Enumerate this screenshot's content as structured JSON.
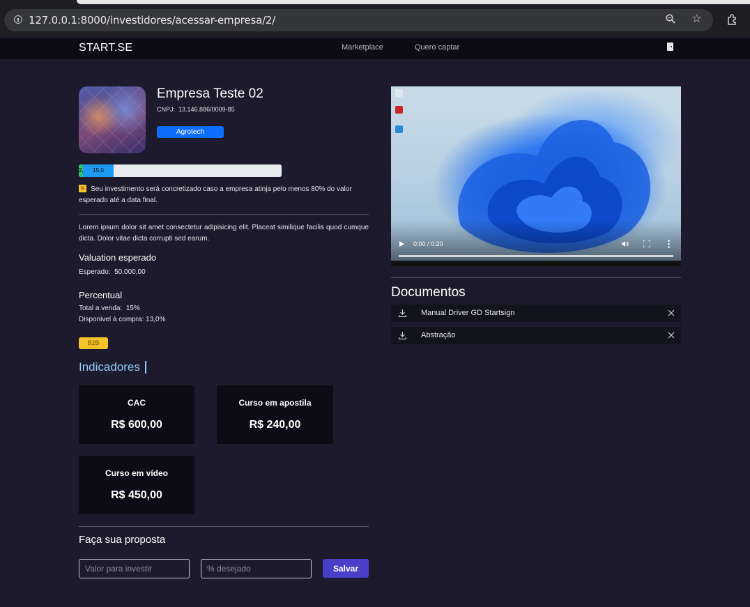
{
  "browser": {
    "url": "127.0.0.1:8000/investidores/acessar-empresa/2/"
  },
  "nav": {
    "brand": "START.SE",
    "links": [
      "Marketplace",
      "Quero captar"
    ]
  },
  "company": {
    "name": "Empresa Teste 02",
    "cnpj_label": "CNPJ:",
    "cnpj": "13.146.886/0009-85",
    "sector": "Agrotech",
    "progress": {
      "achieved_label": "2,",
      "achieved_pct": 2.0,
      "available_label": "15,0",
      "available_pct": 15.0
    },
    "warning": "Seu investimento será concretizado caso a empresa atinja pelo menos 80% do valor esperado até a data final.",
    "description": "Lorem ipsum dolor sit amet consectetur adipisicing elit. Placeat similique facilis quod cumque dicta. Dolor vitae dicta corrupti sed earum.",
    "valuation_title": "Valuation esperado",
    "valuation_label": "Esperado:",
    "valuation_value": "50.000,00",
    "percent_title": "Percentual",
    "total_sale_label": "Total a venda:",
    "total_sale_value": "15%",
    "available_label": "Disponivel à compra:",
    "available_value": "13,0%",
    "model_badge": "B2B"
  },
  "indicators": {
    "title": "Indicadores",
    "cards": [
      {
        "label": "CAC",
        "value": "R$ 600,00"
      },
      {
        "label": "Curso em apostila",
        "value": "R$ 240,00"
      },
      {
        "label": "Curso em vídeo",
        "value": "R$ 450,00"
      }
    ]
  },
  "proposal": {
    "title": "Faça sua proposta",
    "value_placeholder": "Valor para investir",
    "percent_placeholder": "% desejado",
    "save_label": "Salvar"
  },
  "video": {
    "time": "0:00 / 0:20",
    "progress": 0.0
  },
  "documents": {
    "title": "Documentos",
    "items": [
      {
        "name": "Manual Driver GD Startsign"
      },
      {
        "name": "Abstração"
      }
    ]
  },
  "colors": {
    "background": "#1c1a2c",
    "navbar": "#0d0c16",
    "primary": "#0d6efd",
    "warning": "#f6c22a",
    "indicator_title": "#8ecdf2",
    "save_button": "#4a3fc8"
  }
}
